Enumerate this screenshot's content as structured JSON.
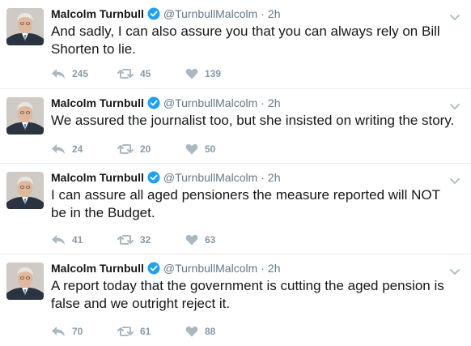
{
  "tweets": [
    {
      "name": "Malcolm Turnbull",
      "handle": "@TurnbullMalcolm",
      "dot": "·",
      "time": "2h",
      "text": "And sadly, I can also assure you that you can always rely on Bill Shorten to lie.",
      "replies": "245",
      "retweets": "45",
      "likes": "139"
    },
    {
      "name": "Malcolm Turnbull",
      "handle": "@TurnbullMalcolm",
      "dot": "·",
      "time": "2h",
      "text": "We assured the journalist too, but she insisted on writing the story.",
      "replies": "24",
      "retweets": "20",
      "likes": "50"
    },
    {
      "name": "Malcolm Turnbull",
      "handle": "@TurnbullMalcolm",
      "dot": "·",
      "time": "2h",
      "text": "I can assure all aged pensioners the measure reported will NOT be in the Budget.",
      "replies": "41",
      "retweets": "32",
      "likes": "63"
    },
    {
      "name": "Malcolm Turnbull",
      "handle": "@TurnbullMalcolm",
      "dot": "·",
      "time": "2h",
      "text": "A report today that the government is cutting the aged pension is false and we outright reject it.",
      "replies": "70",
      "retweets": "61",
      "likes": "88"
    }
  ],
  "colors": {
    "verified": "#1da1f2",
    "icon_gray": "#aab8c2",
    "name": "#14171a",
    "meta": "#657786",
    "divider": "#e6ecf0"
  },
  "icons": {
    "verified": "verified-badge-icon",
    "caret": "chevron-down-icon",
    "reply": "reply-icon",
    "retweet": "retweet-icon",
    "like": "heart-icon",
    "avatar": "profile-photo"
  }
}
